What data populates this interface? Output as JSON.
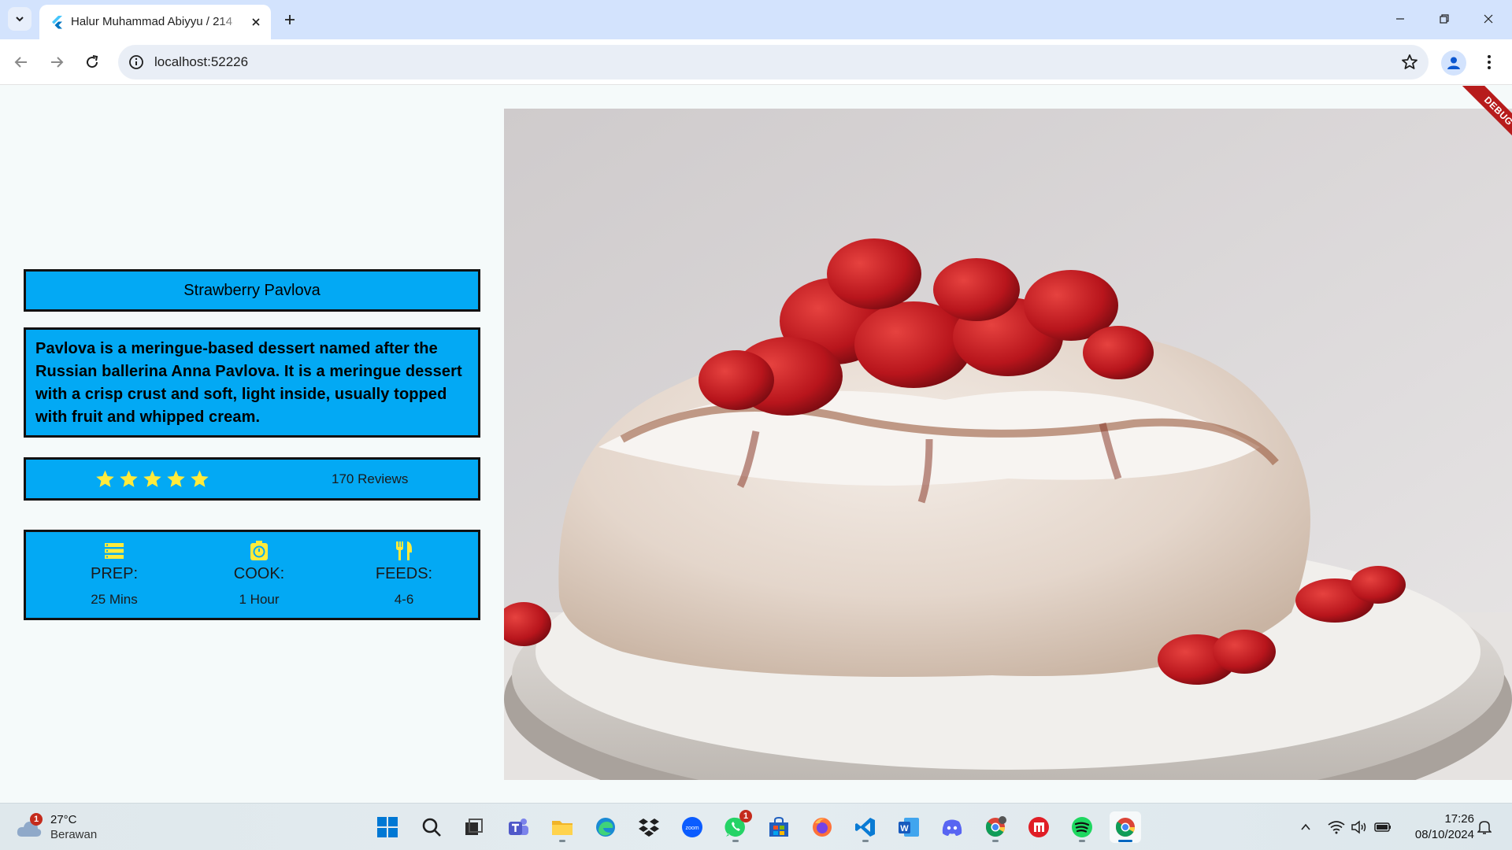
{
  "browser": {
    "tab_title": "Halur Muhammad Abiyyu / 214",
    "url": "localhost:52226"
  },
  "recipe": {
    "title": "Strawberry Pavlova",
    "description": "Pavlova is a meringue-based dessert named after the Russian ballerina Anna Pavlova. It is a meringue dessert with a crisp crust and soft, light inside, usually topped with fruit and whipped cream.",
    "stars": 5,
    "reviews": "170 Reviews",
    "info": [
      {
        "label": "PREP:",
        "value": "25 Mins",
        "icon": "storage-icon"
      },
      {
        "label": "COOK:",
        "value": "1 Hour",
        "icon": "timer-icon"
      },
      {
        "label": "FEEDS:",
        "value": "4-6",
        "icon": "restaurant-icon"
      }
    ],
    "star_color": "#ffeb3b",
    "card_color": "#03a9f4"
  },
  "debug_banner": "DEBUG",
  "taskbar": {
    "weather": {
      "temp": "27°C",
      "condition": "Berawan",
      "badge": "1"
    },
    "apps": [
      "windows-start",
      "search",
      "task-view",
      "teams",
      "file-explorer",
      "edge",
      "dropbox",
      "zoom",
      "whatsapp",
      "microsoft-store",
      "firefox",
      "vs-code",
      "word",
      "discord",
      "chrome-profile",
      "davinci",
      "spotify",
      "chrome"
    ],
    "whatsapp_badge": "1",
    "time": "17:26",
    "date": "08/10/2024"
  }
}
